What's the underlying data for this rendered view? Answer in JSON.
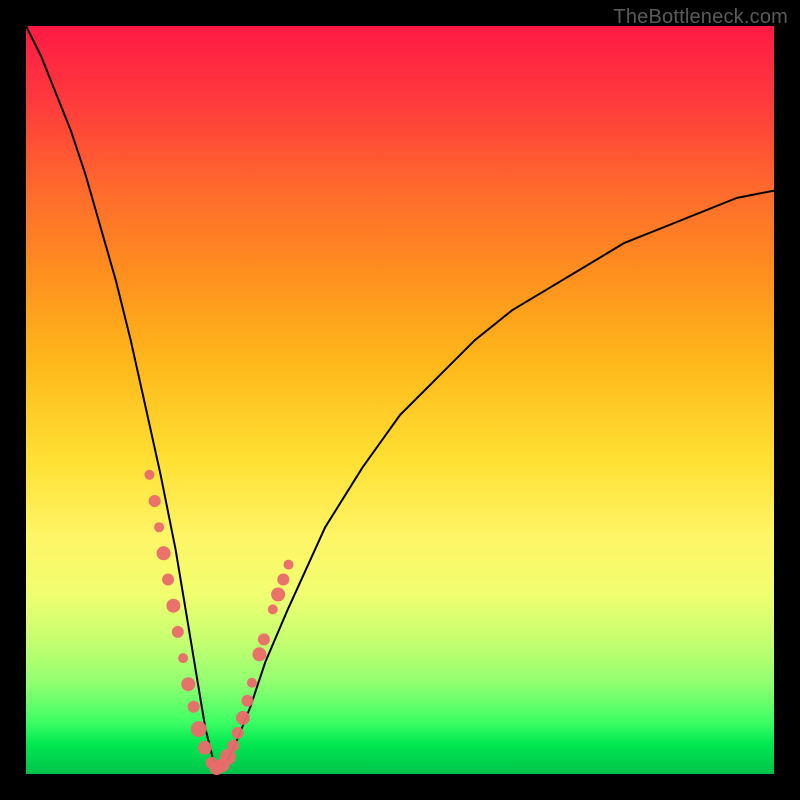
{
  "watermark": "TheBottleneck.com",
  "chart_data": {
    "type": "line",
    "title": "",
    "xlabel": "",
    "ylabel": "",
    "xlim": [
      0,
      100
    ],
    "ylim": [
      0,
      100
    ],
    "curve": {
      "description": "V-shaped bottleneck curve: value drops from ~100 at x=0 to ~0 near x≈25, then rises back toward ~78 at x=100",
      "x": [
        0,
        2,
        4,
        6,
        8,
        10,
        12,
        14,
        16,
        18,
        20,
        22,
        23,
        24,
        25,
        26,
        27,
        28,
        30,
        32,
        35,
        40,
        45,
        50,
        55,
        60,
        65,
        70,
        75,
        80,
        85,
        90,
        95,
        100
      ],
      "y": [
        100,
        96,
        91,
        86,
        80,
        73,
        66,
        58,
        49,
        40,
        30,
        18,
        12,
        6,
        2,
        1,
        2,
        4,
        9,
        15,
        22,
        33,
        41,
        48,
        53,
        58,
        62,
        65,
        68,
        71,
        73,
        75,
        77,
        78
      ]
    },
    "scatter": {
      "description": "Highlighted data points (salmon dots) clustered around the V-trough and lower arms",
      "color": "#ea6a6a",
      "points_x": [
        16.5,
        17.2,
        17.8,
        18.4,
        19.0,
        19.7,
        20.3,
        21.0,
        21.7,
        22.4,
        23.1,
        23.9,
        24.8,
        25.5,
        26.3,
        27.0,
        27.7,
        28.3,
        29.0,
        29.6,
        30.2,
        31.2,
        31.8,
        33.0,
        33.7,
        34.4,
        35.1
      ],
      "points_y": [
        40.0,
        36.5,
        33.0,
        29.5,
        26.0,
        22.5,
        19.0,
        15.5,
        12.0,
        9.0,
        6.0,
        3.5,
        1.5,
        0.8,
        1.2,
        2.3,
        3.8,
        5.5,
        7.5,
        9.8,
        12.2,
        16.0,
        18.0,
        22.0,
        24.0,
        26.0,
        28.0
      ],
      "points_r": [
        5,
        6,
        5,
        7,
        6,
        7,
        6,
        5,
        7,
        6,
        8,
        7,
        6,
        7,
        7,
        8,
        6,
        6,
        7,
        6,
        5,
        7,
        6,
        5,
        7,
        6,
        5
      ]
    },
    "gradient_stops": [
      {
        "pos": 0.0,
        "color": "#ff1a44"
      },
      {
        "pos": 0.5,
        "color": "#ffd633"
      },
      {
        "pos": 1.0,
        "color": "#00c24a"
      }
    ]
  }
}
